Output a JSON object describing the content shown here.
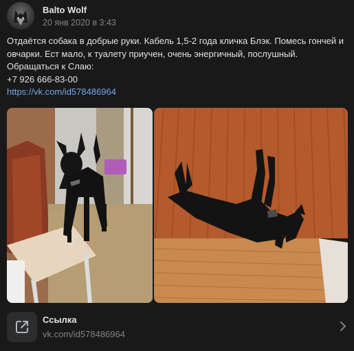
{
  "post": {
    "author": "Balto Wolf",
    "date": "20 янв 2020 в 3:43",
    "text_lines": [
      "Отдаётся собака в добрые руки. Кабель 1,5-2 года кличка Блэк. Помесь гончей и овчарки. Ест мало, к туалету приучен, очень энергичный, послушный.",
      "Обращаться к Слаю:",
      "+7 926 666-83-00"
    ],
    "link_text": "https://vk.com/id578486964"
  },
  "photos": [
    {
      "icon": "dog-standing-photo"
    },
    {
      "icon": "dog-lying-photo"
    }
  ],
  "link_card": {
    "title": "Ссылка",
    "url": "vk.com/id578486964",
    "icon": "external-link-icon"
  },
  "colors": {
    "background": "#19191a",
    "text": "#e1e3e6",
    "secondary": "#828282",
    "link": "#71aaeb"
  }
}
